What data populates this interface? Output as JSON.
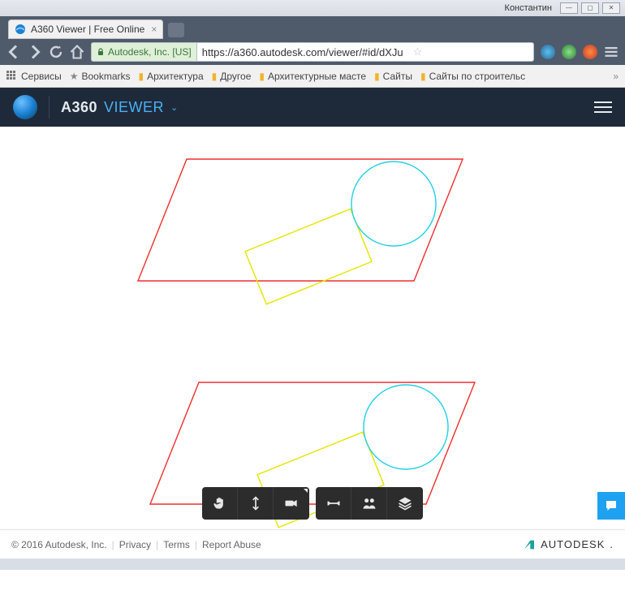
{
  "os": {
    "user_label": "Константин",
    "min_icon": "—",
    "max_icon": "▢",
    "close_icon": "✕"
  },
  "browser": {
    "tab_title": "A360 Viewer | Free Online",
    "url_owner": "Autodesk, Inc. [US]",
    "url": "https://a360.autodesk.com/viewer/#id/dXJu"
  },
  "bookmarks": {
    "apps": "Сервисы",
    "main": "Bookmarks",
    "items": [
      "Архитектура",
      "Другое",
      "Архитектурные масте",
      "Сайты",
      "Сайты по строительс"
    ]
  },
  "app": {
    "title_strong": "A360",
    "title_sub": "VIEWER"
  },
  "drawing": {
    "parallelogram_color": "#ef2f2f",
    "rectangle_color": "#e6e600",
    "circle_color": "#1fd0e6"
  },
  "tools": {
    "group1": [
      "pan",
      "orbit",
      "camera"
    ],
    "group2": [
      "measure",
      "section",
      "layers"
    ]
  },
  "footer": {
    "copyright": "© 2016 Autodesk, Inc.",
    "links": [
      "Privacy",
      "Terms",
      "Report Abuse"
    ],
    "brand": "AUTODESK"
  }
}
